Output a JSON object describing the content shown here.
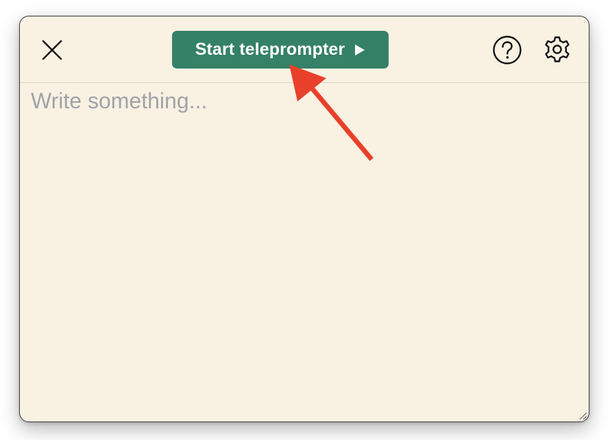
{
  "toolbar": {
    "close_icon": "close-icon",
    "start_button_label": "Start teleprompter",
    "start_button_icon": "play-icon",
    "help_icon": "question-circle-icon",
    "settings_icon": "gear-icon"
  },
  "editor": {
    "placeholder": "Write something...",
    "value": ""
  },
  "annotation": {
    "arrow_color": "#e8402a",
    "points_to": "start-teleprompter-button"
  },
  "colors": {
    "window_background": "#f9f1e2",
    "accent": "#358168",
    "placeholder_text": "#a0a3aa"
  }
}
